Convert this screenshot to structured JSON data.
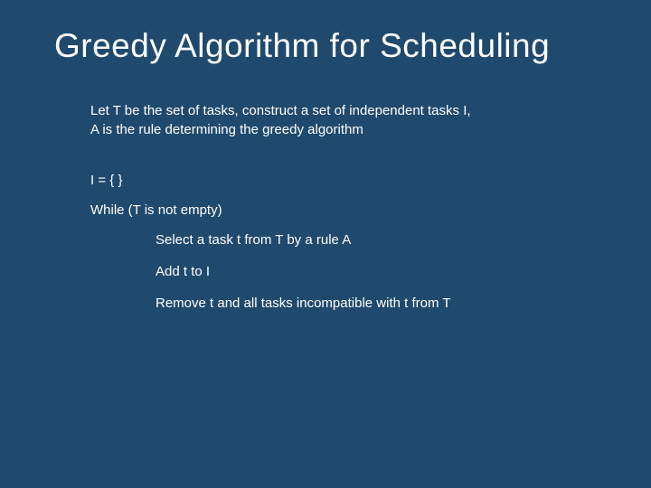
{
  "slide": {
    "title": "Greedy Algorithm for Scheduling",
    "intro": {
      "line1": "Let T be the set of tasks, construct a set of independent tasks I,",
      "line2": "A is the rule determining the greedy algorithm"
    },
    "algorithm": {
      "init": "I = { }",
      "while": "While (T is not empty)",
      "steps": {
        "select": "Select a task t from T by a rule A",
        "add": "Add t to I",
        "remove": "Remove t and all tasks incompatible with t from T"
      }
    }
  }
}
